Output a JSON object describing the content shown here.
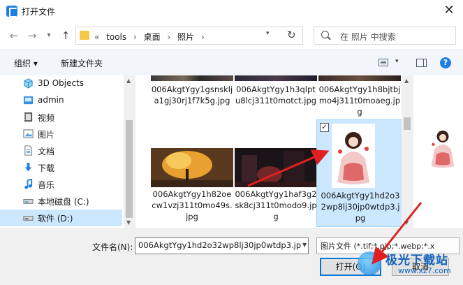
{
  "window": {
    "title": "打开文件",
    "close_glyph": "✕"
  },
  "nav": {
    "back_glyph": "←",
    "forward_glyph": "→",
    "up_glyph": "↑",
    "breadcrumbs": [
      "«",
      "tools",
      "›",
      "桌面",
      "›",
      "照片",
      "›"
    ],
    "search_placeholder": "在 照片 中搜索"
  },
  "toolbar": {
    "organize_label": "组织 ▾",
    "new_folder_label": "新建文件夹",
    "help_glyph": "?"
  },
  "sidebar": {
    "items": [
      {
        "label": "3D Objects",
        "icon": "cube-icon"
      },
      {
        "label": "admin",
        "icon": "user-folder-icon"
      },
      {
        "label": "视频",
        "icon": "video-icon"
      },
      {
        "label": "图片",
        "icon": "picture-icon"
      },
      {
        "label": "文档",
        "icon": "document-icon"
      },
      {
        "label": "下载",
        "icon": "download-icon"
      },
      {
        "label": "音乐",
        "icon": "music-icon"
      },
      {
        "label": "本地磁盘 (C:)",
        "icon": "drive-icon"
      },
      {
        "label": "软件 (D:)",
        "icon": "drive-icon",
        "selected": true
      }
    ]
  },
  "files": [
    {
      "name": "006AkgtYgy1gsnsklja1gj30rj1f7k5g.jpg",
      "selected": false
    },
    {
      "name": "006AkgtYgy1h3qlptu8lcj311t0motct.jpg",
      "selected": false
    },
    {
      "name": "006AkgtYgy1h8bjtbjmo4j311t0moaeg.jpg",
      "selected": false
    },
    {
      "name": "006AkgtYgy1h82oecw1vzj311t0mo49s.jpg",
      "selected": false
    },
    {
      "name": "006AkgtYgy1haf3g2sk8cj311t0modo9.jpg",
      "selected": false
    },
    {
      "name": "006AkgtYgy1hd2o32wp8lj30jp0wtdp3.jpg",
      "selected": true
    }
  ],
  "bottom": {
    "filename_label": "文件名(N):",
    "filename_value": "006AkgtYgy1hd2o32wp8lj30jp0wtdp3.jp",
    "filetype_value": "图片文件 (*.tif;*.pjp;*.webp;*.x",
    "open_label": "打开(O)",
    "cancel_label": "取消"
  },
  "watermark": {
    "title": "极光下载站",
    "url": "www.xz7.com"
  },
  "colors": {
    "accent": "#0078d7",
    "selection": "#cce8ff",
    "arrow": "#e02020"
  }
}
